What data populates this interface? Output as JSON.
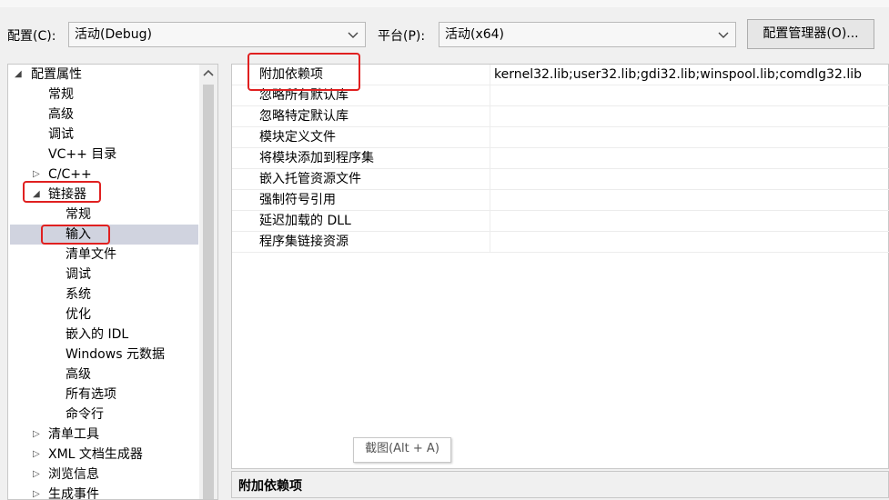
{
  "toolbar": {
    "config_label": "配置(C):",
    "config_value": "活动(Debug)",
    "platform_label": "平台(P):",
    "platform_value": "活动(x64)",
    "manager_button": "配置管理器(O)..."
  },
  "tree": {
    "root": "配置属性",
    "items": {
      "general": "常规",
      "advanced": "高级",
      "debugging": "调试",
      "vc_dirs": "VC++ 目录",
      "cpp": "C/C++",
      "linker": "链接器",
      "linker_general": "常规",
      "linker_input": "输入",
      "linker_manifest": "清单文件",
      "linker_debug": "调试",
      "linker_system": "系统",
      "linker_optimize": "优化",
      "linker_idl": "嵌入的 IDL",
      "linker_winmd": "Windows 元数据",
      "linker_advanced": "高级",
      "linker_all": "所有选项",
      "linker_cmdline": "命令行",
      "manifest_tool": "清单工具",
      "xml_doc": "XML 文档生成器",
      "browse_info": "浏览信息",
      "build_events": "生成事件"
    }
  },
  "grid": {
    "rows": [
      {
        "name": "附加依赖项",
        "value": "kernel32.lib;user32.lib;gdi32.lib;winspool.lib;comdlg32.lib"
      },
      {
        "name": "忽略所有默认库",
        "value": ""
      },
      {
        "name": "忽略特定默认库",
        "value": ""
      },
      {
        "name": "模块定义文件",
        "value": ""
      },
      {
        "name": "将模块添加到程序集",
        "value": ""
      },
      {
        "name": "嵌入托管资源文件",
        "value": ""
      },
      {
        "name": "强制符号引用",
        "value": ""
      },
      {
        "name": "延迟加载的 DLL",
        "value": ""
      },
      {
        "name": "程序集链接资源",
        "value": ""
      }
    ]
  },
  "description": {
    "title": "附加依赖项"
  },
  "tooltip": "截图(Alt + A)",
  "colors": {
    "highlight": "#e02020",
    "selection": "#d0d3df"
  }
}
